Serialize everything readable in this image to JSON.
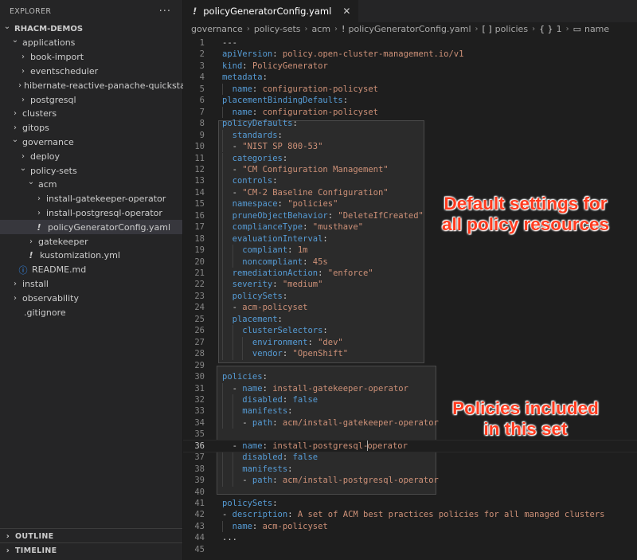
{
  "explorer": {
    "title": "EXPLORER",
    "more_actions": "···",
    "tree": [
      {
        "label": "RHACM-DEMOS",
        "depth": 0,
        "type": "root",
        "open": true
      },
      {
        "label": "applications",
        "depth": 1,
        "type": "folder",
        "open": true
      },
      {
        "label": "book-import",
        "depth": 2,
        "type": "folder",
        "open": false
      },
      {
        "label": "eventscheduler",
        "depth": 2,
        "type": "folder",
        "open": false
      },
      {
        "label": "hibernate-reactive-panache-quickstart",
        "depth": 2,
        "type": "folder",
        "open": false
      },
      {
        "label": "postgresql",
        "depth": 2,
        "type": "folder",
        "open": false
      },
      {
        "label": "clusters",
        "depth": 1,
        "type": "folder",
        "open": false
      },
      {
        "label": "gitops",
        "depth": 1,
        "type": "folder",
        "open": false
      },
      {
        "label": "governance",
        "depth": 1,
        "type": "folder",
        "open": true
      },
      {
        "label": "deploy",
        "depth": 2,
        "type": "folder",
        "open": false
      },
      {
        "label": "policy-sets",
        "depth": 2,
        "type": "folder",
        "open": true
      },
      {
        "label": "acm",
        "depth": 3,
        "type": "folder",
        "open": true
      },
      {
        "label": "install-gatekeeper-operator",
        "depth": 4,
        "type": "folder",
        "open": false
      },
      {
        "label": "install-postgresql-operator",
        "depth": 4,
        "type": "folder",
        "open": false
      },
      {
        "label": "policyGeneratorConfig.yaml",
        "depth": 4,
        "type": "yaml",
        "selected": true
      },
      {
        "label": "gatekeeper",
        "depth": 3,
        "type": "folder",
        "open": false
      },
      {
        "label": "kustomization.yml",
        "depth": 3,
        "type": "yaml"
      },
      {
        "label": "README.md",
        "depth": 2,
        "type": "info"
      },
      {
        "label": "install",
        "depth": 1,
        "type": "folder",
        "open": false
      },
      {
        "label": "observability",
        "depth": 1,
        "type": "folder",
        "open": false
      },
      {
        "label": ".gitignore",
        "depth": 1,
        "type": "file"
      }
    ],
    "outline_label": "OUTLINE",
    "timeline_label": "TIMELINE"
  },
  "editor": {
    "tab": {
      "icon": "!",
      "title": "policyGeneratorConfig.yaml",
      "close": "✕"
    },
    "breadcrumb": [
      {
        "label": "governance"
      },
      {
        "label": "policy-sets"
      },
      {
        "label": "acm"
      },
      {
        "icon": "!",
        "label": "policyGeneratorConfig.yaml"
      },
      {
        "icon": "[ ]",
        "label": "policies"
      },
      {
        "icon": "{ }",
        "label": "1"
      },
      {
        "icon": "▭",
        "label": "name"
      }
    ],
    "current_line": 36,
    "lines": [
      {
        "n": 1,
        "indent": 0,
        "tokens": [
          {
            "t": "---",
            "c": "p"
          }
        ]
      },
      {
        "n": 2,
        "indent": 0,
        "tokens": [
          {
            "t": "apiVersion",
            "c": "k"
          },
          {
            "t": ": ",
            "c": "p"
          },
          {
            "t": "policy.open-cluster-management.io/v1",
            "c": "s"
          }
        ]
      },
      {
        "n": 3,
        "indent": 0,
        "tokens": [
          {
            "t": "kind",
            "c": "k"
          },
          {
            "t": ": ",
            "c": "p"
          },
          {
            "t": "PolicyGenerator",
            "c": "s"
          }
        ]
      },
      {
        "n": 4,
        "indent": 0,
        "tokens": [
          {
            "t": "metadata",
            "c": "k"
          },
          {
            "t": ":",
            "c": "p"
          }
        ]
      },
      {
        "n": 5,
        "indent": 1,
        "tokens": [
          {
            "t": "name",
            "c": "k"
          },
          {
            "t": ": ",
            "c": "p"
          },
          {
            "t": "configuration-policyset",
            "c": "s"
          }
        ]
      },
      {
        "n": 6,
        "indent": 0,
        "tokens": [
          {
            "t": "placementBindingDefaults",
            "c": "k"
          },
          {
            "t": ":",
            "c": "p"
          }
        ]
      },
      {
        "n": 7,
        "indent": 1,
        "tokens": [
          {
            "t": "name",
            "c": "k"
          },
          {
            "t": ": ",
            "c": "p"
          },
          {
            "t": "configuration-policyset",
            "c": "s"
          }
        ]
      },
      {
        "n": 8,
        "indent": 0,
        "tokens": [
          {
            "t": "policyDefaults",
            "c": "k"
          },
          {
            "t": ":",
            "c": "p"
          }
        ]
      },
      {
        "n": 9,
        "indent": 1,
        "tokens": [
          {
            "t": "standards",
            "c": "k"
          },
          {
            "t": ":",
            "c": "p"
          }
        ]
      },
      {
        "n": 10,
        "indent": 1,
        "tokens": [
          {
            "t": "- ",
            "c": "p"
          },
          {
            "t": "\"NIST SP 800-53\"",
            "c": "s"
          }
        ]
      },
      {
        "n": 11,
        "indent": 1,
        "tokens": [
          {
            "t": "categories",
            "c": "k"
          },
          {
            "t": ":",
            "c": "p"
          }
        ]
      },
      {
        "n": 12,
        "indent": 1,
        "tokens": [
          {
            "t": "- ",
            "c": "p"
          },
          {
            "t": "\"CM Configuration Management\"",
            "c": "s"
          }
        ]
      },
      {
        "n": 13,
        "indent": 1,
        "tokens": [
          {
            "t": "controls",
            "c": "k"
          },
          {
            "t": ":",
            "c": "p"
          }
        ]
      },
      {
        "n": 14,
        "indent": 1,
        "tokens": [
          {
            "t": "- ",
            "c": "p"
          },
          {
            "t": "\"CM-2 Baseline Configuration\"",
            "c": "s"
          }
        ]
      },
      {
        "n": 15,
        "indent": 1,
        "tokens": [
          {
            "t": "namespace",
            "c": "k"
          },
          {
            "t": ": ",
            "c": "p"
          },
          {
            "t": "\"policies\"",
            "c": "s"
          }
        ]
      },
      {
        "n": 16,
        "indent": 1,
        "tokens": [
          {
            "t": "pruneObjectBehavior",
            "c": "k"
          },
          {
            "t": ": ",
            "c": "p"
          },
          {
            "t": "\"DeleteIfCreated\"",
            "c": "s"
          }
        ]
      },
      {
        "n": 17,
        "indent": 1,
        "tokens": [
          {
            "t": "complianceType",
            "c": "k"
          },
          {
            "t": ": ",
            "c": "p"
          },
          {
            "t": "\"musthave\"",
            "c": "s"
          }
        ]
      },
      {
        "n": 18,
        "indent": 1,
        "tokens": [
          {
            "t": "evaluationInterval",
            "c": "k"
          },
          {
            "t": ":",
            "c": "p"
          }
        ]
      },
      {
        "n": 19,
        "indent": 2,
        "tokens": [
          {
            "t": "compliant",
            "c": "k"
          },
          {
            "t": ": ",
            "c": "p"
          },
          {
            "t": "1m",
            "c": "s"
          }
        ]
      },
      {
        "n": 20,
        "indent": 2,
        "tokens": [
          {
            "t": "noncompliant",
            "c": "k"
          },
          {
            "t": ": ",
            "c": "p"
          },
          {
            "t": "45s",
            "c": "s"
          }
        ]
      },
      {
        "n": 21,
        "indent": 1,
        "tokens": [
          {
            "t": "remediationAction",
            "c": "k"
          },
          {
            "t": ": ",
            "c": "p"
          },
          {
            "t": "\"enforce\"",
            "c": "s"
          }
        ]
      },
      {
        "n": 22,
        "indent": 1,
        "tokens": [
          {
            "t": "severity",
            "c": "k"
          },
          {
            "t": ": ",
            "c": "p"
          },
          {
            "t": "\"medium\"",
            "c": "s"
          }
        ]
      },
      {
        "n": 23,
        "indent": 1,
        "tokens": [
          {
            "t": "policySets",
            "c": "k"
          },
          {
            "t": ":",
            "c": "p"
          }
        ]
      },
      {
        "n": 24,
        "indent": 1,
        "tokens": [
          {
            "t": "- ",
            "c": "p"
          },
          {
            "t": "acm-policyset",
            "c": "s"
          }
        ]
      },
      {
        "n": 25,
        "indent": 1,
        "tokens": [
          {
            "t": "placement",
            "c": "k"
          },
          {
            "t": ":",
            "c": "p"
          }
        ]
      },
      {
        "n": 26,
        "indent": 2,
        "tokens": [
          {
            "t": "clusterSelectors",
            "c": "k"
          },
          {
            "t": ":",
            "c": "p"
          }
        ]
      },
      {
        "n": 27,
        "indent": 3,
        "tokens": [
          {
            "t": "environment",
            "c": "k"
          },
          {
            "t": ": ",
            "c": "p"
          },
          {
            "t": "\"dev\"",
            "c": "s"
          }
        ]
      },
      {
        "n": 28,
        "indent": 3,
        "tokens": [
          {
            "t": "vendor",
            "c": "k"
          },
          {
            "t": ": ",
            "c": "p"
          },
          {
            "t": "\"OpenShift\"",
            "c": "s"
          }
        ]
      },
      {
        "n": 29,
        "indent": 0,
        "tokens": []
      },
      {
        "n": 30,
        "indent": 0,
        "tokens": [
          {
            "t": "policies",
            "c": "k"
          },
          {
            "t": ":",
            "c": "p"
          }
        ]
      },
      {
        "n": 31,
        "indent": 1,
        "tokens": [
          {
            "t": "- ",
            "c": "p"
          },
          {
            "t": "name",
            "c": "k"
          },
          {
            "t": ": ",
            "c": "p"
          },
          {
            "t": "install-gatekeeper-operator",
            "c": "s"
          }
        ]
      },
      {
        "n": 32,
        "indent": 2,
        "tokens": [
          {
            "t": "disabled",
            "c": "k"
          },
          {
            "t": ": ",
            "c": "p"
          },
          {
            "t": "false",
            "c": "k"
          }
        ]
      },
      {
        "n": 33,
        "indent": 2,
        "tokens": [
          {
            "t": "manifests",
            "c": "k"
          },
          {
            "t": ":",
            "c": "p"
          }
        ]
      },
      {
        "n": 34,
        "indent": 2,
        "tokens": [
          {
            "t": "- ",
            "c": "p"
          },
          {
            "t": "path",
            "c": "k"
          },
          {
            "t": ": ",
            "c": "p"
          },
          {
            "t": "acm/install-gatekeeper-operator",
            "c": "s"
          }
        ]
      },
      {
        "n": 35,
        "indent": 0,
        "tokens": []
      },
      {
        "n": 36,
        "indent": 1,
        "tokens": [
          {
            "t": "- ",
            "c": "p"
          },
          {
            "t": "name",
            "c": "k"
          },
          {
            "t": ": ",
            "c": "p"
          },
          {
            "t": "install-postgresql-",
            "c": "s"
          },
          {
            "cursor": true
          },
          {
            "t": "operator",
            "c": "s"
          }
        ]
      },
      {
        "n": 37,
        "indent": 2,
        "tokens": [
          {
            "t": "disabled",
            "c": "k"
          },
          {
            "t": ": ",
            "c": "p"
          },
          {
            "t": "false",
            "c": "k"
          }
        ]
      },
      {
        "n": 38,
        "indent": 2,
        "tokens": [
          {
            "t": "manifests",
            "c": "k"
          },
          {
            "t": ":",
            "c": "p"
          }
        ]
      },
      {
        "n": 39,
        "indent": 2,
        "tokens": [
          {
            "t": "- ",
            "c": "p"
          },
          {
            "t": "path",
            "c": "k"
          },
          {
            "t": ": ",
            "c": "p"
          },
          {
            "t": "acm/install-postgresql-operator",
            "c": "s"
          }
        ]
      },
      {
        "n": 40,
        "indent": 0,
        "tokens": []
      },
      {
        "n": 41,
        "indent": 0,
        "tokens": [
          {
            "t": "policySets",
            "c": "k"
          },
          {
            "t": ":",
            "c": "p"
          }
        ]
      },
      {
        "n": 42,
        "indent": 0,
        "tokens": [
          {
            "t": "- ",
            "c": "p"
          },
          {
            "t": "description",
            "c": "k"
          },
          {
            "t": ": ",
            "c": "p"
          },
          {
            "t": "A set of ACM best practices policies for all managed clusters",
            "c": "s"
          }
        ]
      },
      {
        "n": 43,
        "indent": 1,
        "tokens": [
          {
            "t": "name",
            "c": "k"
          },
          {
            "t": ": ",
            "c": "p"
          },
          {
            "t": "acm-policyset",
            "c": "s"
          }
        ]
      },
      {
        "n": 44,
        "indent": 0,
        "tokens": [
          {
            "t": "...",
            "c": "p"
          }
        ]
      },
      {
        "n": 45,
        "indent": 0,
        "tokens": []
      }
    ]
  },
  "annotations": {
    "defaults_line1": "Default settings for",
    "defaults_line2": "all policy resources",
    "policies_line1": "Policies included",
    "policies_line2": "in this set"
  },
  "colors": {
    "keyword": "#569cd6",
    "string": "#ce9178",
    "annotation_text": "#ff3b1f",
    "editor_bg": "#1e1e1e",
    "sidebar_bg": "#252526"
  }
}
